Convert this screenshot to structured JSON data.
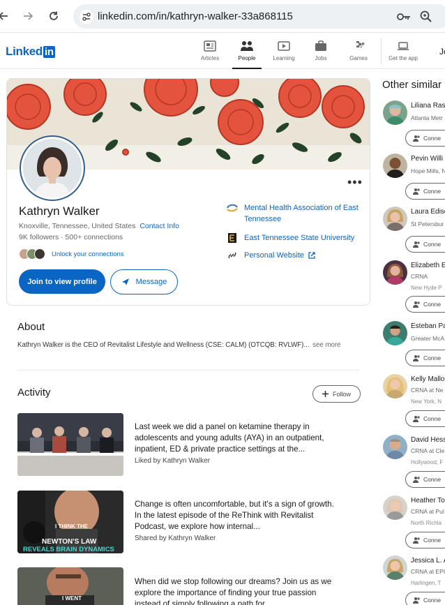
{
  "browser": {
    "url": "linkedin.com/in/kathryn-walker-33a868115"
  },
  "header": {
    "logo_text": "Linked",
    "logo_box": "in",
    "nav": [
      {
        "label": "Articles",
        "icon": "articles-icon"
      },
      {
        "label": "People",
        "icon": "people-icon"
      },
      {
        "label": "Learning",
        "icon": "learning-icon"
      },
      {
        "label": "Jobs",
        "icon": "jobs-icon"
      },
      {
        "label": "Games",
        "icon": "games-icon"
      },
      {
        "label": "Get the app",
        "icon": "laptop-icon"
      }
    ],
    "join_partial": "Jo"
  },
  "profile": {
    "name": "Kathryn Walker",
    "location": "Knoxville, Tennessee, United States",
    "contact_info": "Contact Info",
    "followers": "9K followers",
    "connections": "500+ connections",
    "unlock": "Unlock your connections",
    "join_button": "Join to view profile",
    "message_button": "Message",
    "company_line1": "Mental Health Association of East",
    "company_line2": "Tennessee",
    "school": "East Tennessee State University",
    "website": "Personal Website"
  },
  "about": {
    "title": "About",
    "text": "Kathryn Walker is the CEO of Revitalist Lifestyle and Wellness (CSE: CALM) (OTCQB: RVLWF)...",
    "see_more": "see more"
  },
  "activity": {
    "title": "Activity",
    "follow_button": "Follow",
    "posts": [
      {
        "line1": "Last week we did a panel on ketamine therapy in",
        "line2": "adolescents and young adults (AYA) in an outpatient,",
        "line3": "inpatient, ED & private practice settings at the...",
        "meta": "Liked by Kathryn Walker"
      },
      {
        "line1": "Change is often uncomfortable, but it's a sign of growth.",
        "line2": "In the latest episode of the ReThink with Revitalist",
        "line3": "Podcast, we explore how internal...",
        "meta": "Shared by Kathryn Walker",
        "thumb_line1": "I THINK THE",
        "thumb_line2": "NEWTON'S LAW",
        "thumb_line3": "REVEALS BRAIN DYNAMICS"
      },
      {
        "line1": "When did we stop following our dreams? Join us as we",
        "line2": "explore the importance of finding your true passion",
        "line3": "instead of simply following a path for...",
        "thumb_line1": "I WENT"
      }
    ]
  },
  "similar": {
    "title": "Other similar",
    "connect_label": "Conne",
    "people": [
      {
        "name": "Liliana Ras",
        "sub": "Atlanta Metr",
        "sub2": ""
      },
      {
        "name": "Pevin Willi",
        "sub": "Hope Mills, N",
        "sub2": ""
      },
      {
        "name": "Laura Edise",
        "sub": "St Petersbur",
        "sub2": ""
      },
      {
        "name": "Elizabeth E",
        "sub": "CRNA",
        "sub2": "New Hyde P"
      },
      {
        "name": "Esteban Pa",
        "sub": "Greater McA",
        "sub2": ""
      },
      {
        "name": "Kelly Mallo",
        "sub": "CRNA at Ne",
        "sub2": "New York, N"
      },
      {
        "name": "David Hess",
        "sub": "CRNA at Cle",
        "sub2": "Hollywood, F"
      },
      {
        "name": "Heather To",
        "sub": "CRNA at Pul",
        "sub2": "North Richla"
      },
      {
        "name": "Jessica L. A",
        "sub": "CRNA at EPI",
        "sub2": "Harlingen, T"
      }
    ]
  },
  "colors": {
    "brand": "#0a66c2",
    "banner_flower": "#e4533d",
    "banner_leaf": "#1f3a24"
  }
}
